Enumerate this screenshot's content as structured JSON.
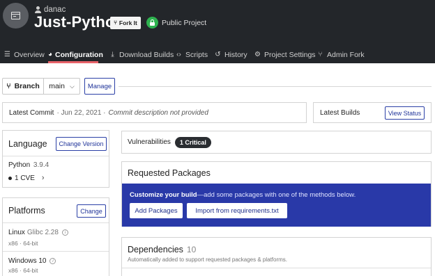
{
  "header": {
    "owner": "danac",
    "project_name": "Just-Python",
    "fork_label": "Fork It",
    "visibility_label": "Public Project",
    "accent_color": "#e8636a",
    "public_color": "#2eb24f"
  },
  "tabs": [
    {
      "label": "Overview",
      "icon": "menu-icon",
      "active": false
    },
    {
      "label": "Configuration",
      "icon": "gauge-icon",
      "active": true
    },
    {
      "label": "Download Builds",
      "icon": "download-icon",
      "active": false
    },
    {
      "label": "Scripts",
      "icon": "code-icon",
      "active": false
    },
    {
      "label": "History",
      "icon": "history-icon",
      "active": false
    },
    {
      "label": "Project Settings",
      "icon": "gear-icon",
      "active": false
    },
    {
      "label": "Admin Fork",
      "icon": "fork-icon",
      "active": false
    }
  ],
  "branch": {
    "label": "Branch",
    "value": "main",
    "manage_label": "Manage"
  },
  "commit": {
    "label": "Latest Commit",
    "date": "· Jun 22, 2021 ·",
    "description": "Commit description not provided"
  },
  "builds": {
    "label": "Latest Builds",
    "button_label": "View Status"
  },
  "language": {
    "title": "Language",
    "change_label": "Change Version",
    "name": "Python",
    "version": "3.9.4",
    "cve_label": "1 CVE"
  },
  "platforms": {
    "title": "Platforms",
    "change_label": "Change",
    "items": [
      {
        "name": "Linux",
        "lib": "Glibc 2.28",
        "arch": "x86 · 64-bit"
      },
      {
        "name": "Windows 10",
        "lib": "",
        "arch": "x86 · 64-bit"
      }
    ]
  },
  "vulnerabilities": {
    "label": "Vulnerabilities",
    "badge": "1 Critical"
  },
  "requested_packages": {
    "title": "Requested Packages",
    "customize_strong": "Customize your build",
    "customize_rest": "—add some packages with one of the methods below.",
    "add_label": "Add Packages",
    "import_label": "Import from requirements.txt",
    "panel_color": "#2939a8"
  },
  "dependencies": {
    "title": "Dependencies",
    "count": "10",
    "description": "Automatically added to support requested packages & platforms."
  }
}
